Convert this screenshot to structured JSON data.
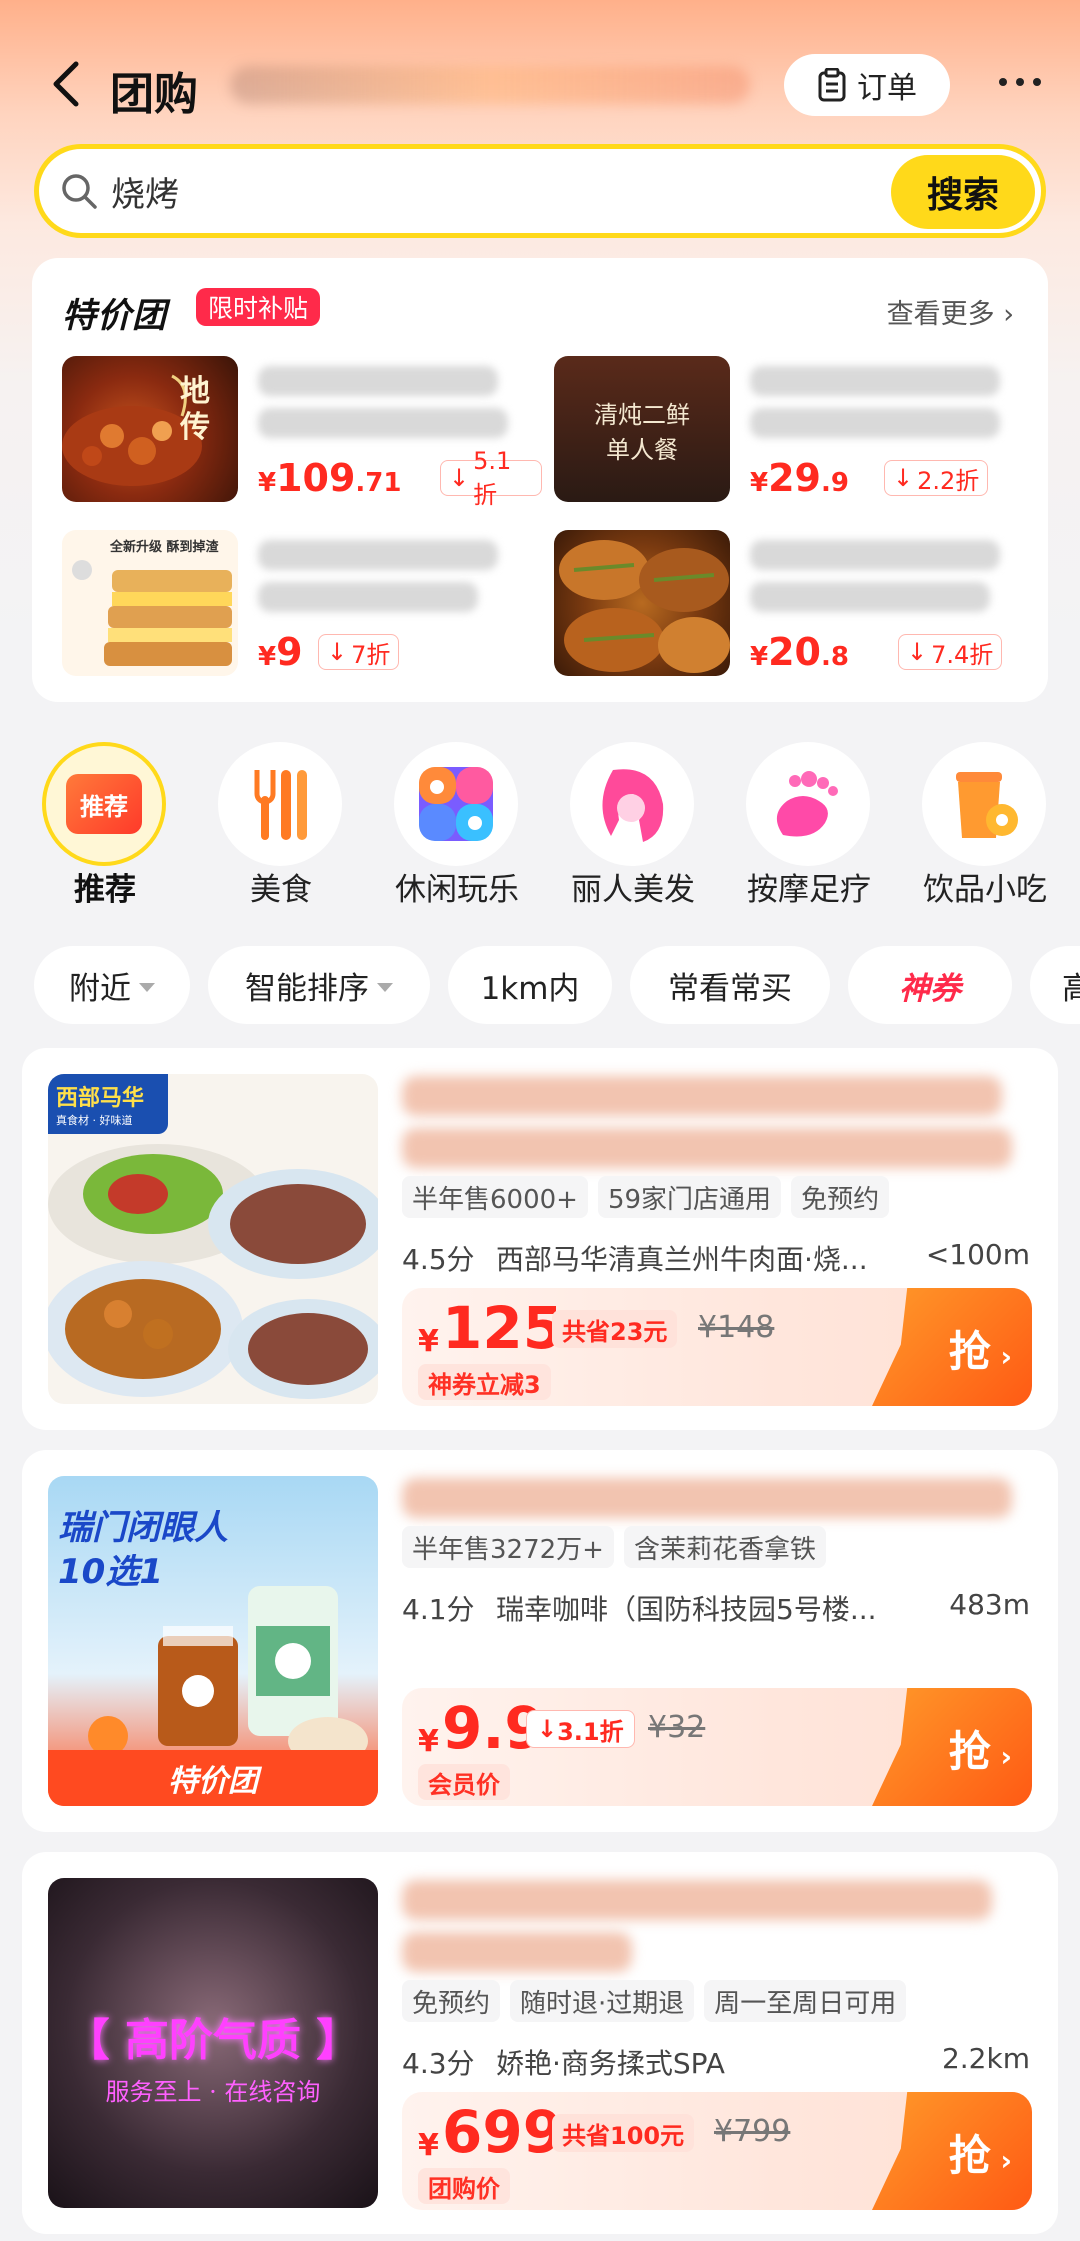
{
  "header": {
    "title": "团购",
    "order_label": "订单"
  },
  "search": {
    "query": "烧烤",
    "button": "搜索"
  },
  "promo": {
    "brand": "特价团",
    "badge": "限时补贴",
    "more": "查看更多",
    "deals": [
      {
        "image_text": "地\n传",
        "currency": "¥",
        "price_int": "109",
        "price_dec": ".71",
        "discount": "5.1折"
      },
      {
        "image_text": "清炖二鲜\n单人餐",
        "currency": "¥",
        "price_int": "29",
        "price_dec": ".9",
        "discount": "2.2折"
      },
      {
        "image_text": "全新升级 酥到掉渣",
        "currency": "¥",
        "price_int": "9",
        "price_dec": "",
        "discount": "7折"
      },
      {
        "image_text": "",
        "currency": "¥",
        "price_int": "20",
        "price_dec": ".8",
        "discount": "7.4折"
      }
    ]
  },
  "categories": [
    {
      "label": "推荐",
      "icon": "recommend-icon",
      "icon_text": "推荐",
      "active": true
    },
    {
      "label": "美食",
      "icon": "fork-knife-icon"
    },
    {
      "label": "休闲玩乐",
      "icon": "leisure-icon"
    },
    {
      "label": "丽人美发",
      "icon": "beauty-hair-icon"
    },
    {
      "label": "按摩足疗",
      "icon": "foot-massage-icon"
    },
    {
      "label": "饮品小吃",
      "icon": "drink-snack-icon"
    }
  ],
  "filters": [
    "附近",
    "智能排序",
    "1km内",
    "常看常买",
    "神券",
    "高"
  ],
  "listings": [
    {
      "image_logo": "西部马华",
      "image_logo_sub": "真食材 · 好味道",
      "tags": [
        "半年售6000+",
        "59家门店通用",
        "免预约"
      ],
      "score": "4.5分",
      "shop": "西部马华清真兰州牛肉面·烧...",
      "distance": "<100m",
      "currency": "¥",
      "price": "125",
      "save": "共省23元",
      "old_price": "¥148",
      "sub_label": "神券立减3",
      "grab": "抢"
    },
    {
      "image_title": "瑞门闭眼人\n10选1",
      "image_footer": "特价团",
      "tags": [
        "半年售3272万+",
        "含茉莉花香拿铁"
      ],
      "score": "4.1分",
      "shop": "瑞幸咖啡（国防科技园5号楼...",
      "distance": "483m",
      "currency": "¥",
      "price": "9.9",
      "save": "3.1折",
      "old_price": "¥32",
      "sub_label": "会员价",
      "grab": "抢"
    },
    {
      "image_title": "【 高阶气质 】",
      "image_sub": "服务至上 · 在线咨询",
      "tags": [
        "免预约",
        "随时退·过期退",
        "周一至周日可用"
      ],
      "score": "4.3分",
      "shop": "娇艳·商务揉式SPA",
      "distance": "2.2km",
      "currency": "¥",
      "price": "699",
      "save": "共省100元",
      "old_price": "¥799",
      "sub_label": "团购价",
      "grab": "抢"
    }
  ],
  "colors": {
    "accent_yellow": "#ffd91a",
    "price_red": "#ff2a20",
    "grab_orange": "#ff6a1a"
  }
}
